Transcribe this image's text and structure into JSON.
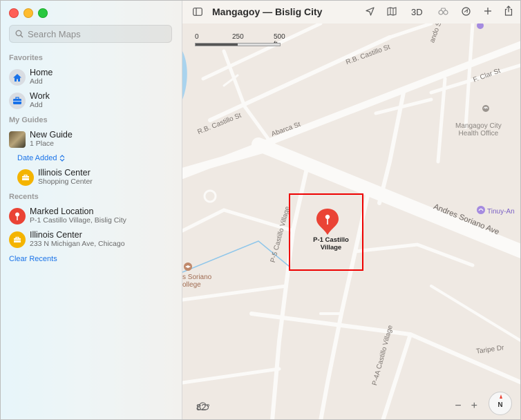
{
  "window": {
    "title": "Mangagoy — Bislig City"
  },
  "search": {
    "placeholder": "Search Maps"
  },
  "favorites": {
    "title": "Favorites",
    "items": [
      {
        "label": "Home",
        "sub": "Add"
      },
      {
        "label": "Work",
        "sub": "Add"
      }
    ]
  },
  "guides": {
    "title": "My Guides",
    "items": [
      {
        "label": "New Guide",
        "sub": "1 Place"
      }
    ],
    "sort_label": "Date Added",
    "places": [
      {
        "label": "Illinois Center",
        "sub": "Shopping Center"
      }
    ]
  },
  "recents": {
    "title": "Recents",
    "items": [
      {
        "label": "Marked Location",
        "sub": "P-1 Castillo Village, Bislig City"
      },
      {
        "label": "Illinois Center",
        "sub": "233 N Michigan Ave, Chicago"
      }
    ],
    "clear_label": "Clear Recents"
  },
  "toolbar": {
    "threed_label": "3D"
  },
  "map": {
    "scale": {
      "t0": "0",
      "t1": "250",
      "t2": "500 ft"
    },
    "streets": {
      "rb_castillo_top": "R.B. Castillo St",
      "rb_castillo_left": "R.B. Castillo St",
      "abarca": "Abarca St",
      "f_clar": "F. Clar St",
      "andres": "Andres Soriano Ave",
      "p5": "P-5 Castillo Village",
      "p4a": "P-4A Castillo Village",
      "tripe": "Taripe Dr",
      "ando": "ando St"
    },
    "pois": {
      "health": "Mangagoy City\nHealth Office",
      "tinuy": "Tinuy-An",
      "soriano": "s Soriano\nollege"
    },
    "pin_label": "P-1 Castillo\nVillage",
    "weather": "82°",
    "compass": "N"
  },
  "colors": {
    "accent": "#1a73e8",
    "pin": "#ea4335",
    "selection": "#e00000"
  }
}
